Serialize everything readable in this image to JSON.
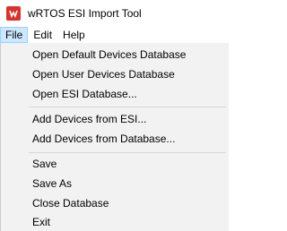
{
  "window": {
    "title": "wRTOS ESI Import Tool",
    "icon": "app-logo-icon",
    "icon_color": "#d9322b"
  },
  "menubar": {
    "items": [
      {
        "label": "File",
        "active": true
      },
      {
        "label": "Edit",
        "active": false
      },
      {
        "label": "Help",
        "active": false
      }
    ],
    "active_bg": "#cce8ff",
    "active_border": "#99d1ff"
  },
  "file_menu": {
    "groups": [
      [
        "Open Default Devices Database",
        "Open User Devices Database",
        "Open ESI Database..."
      ],
      [
        "Add Devices from ESI...",
        "Add Devices from Database..."
      ],
      [
        "Save",
        "Save As",
        "Close Database",
        "Exit"
      ]
    ]
  }
}
